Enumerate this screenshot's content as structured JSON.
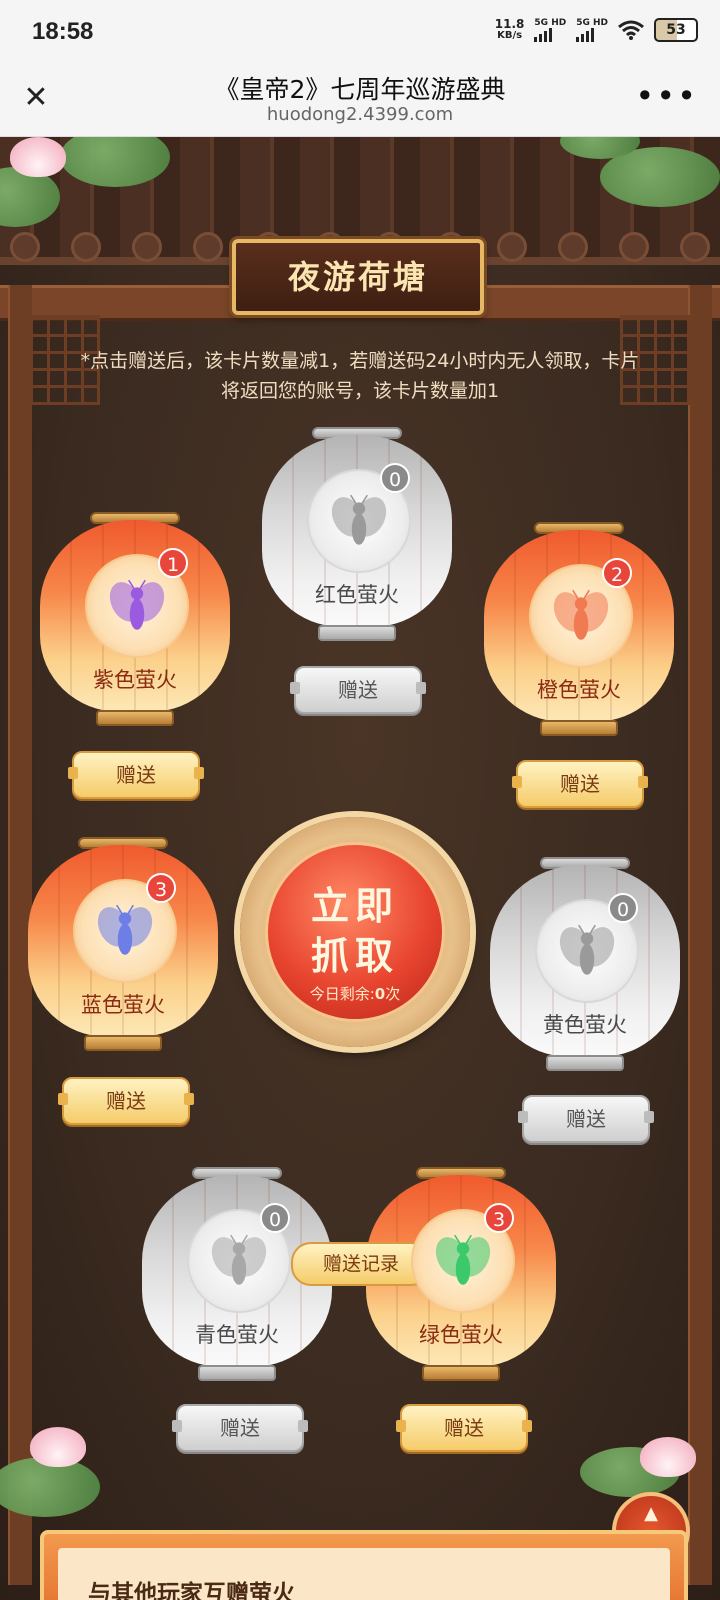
{
  "status": {
    "time": "18:58",
    "net_speed": "11.8",
    "net_unit": "KB/s",
    "sim1": "5G HD",
    "sim2": "5G HD",
    "battery": "53"
  },
  "nav": {
    "title": "《皇帝2》七周年巡游盛典",
    "url": "huodong2.4399.com",
    "close_icon": "close-icon",
    "more_icon": "more-icon"
  },
  "page": {
    "title": "夜游荷塘",
    "notice": "*点击赠送后，该卡片数量减1，若赠送码24小时内无人领取，卡片将返回您的账号，该卡片数量加1",
    "catch_line1": "立即",
    "catch_line2": "抓取",
    "remaining_label": "今日剩余:",
    "remaining_count": "0",
    "remaining_unit": "次",
    "record_label": "赠送记录",
    "top_label": "顶部",
    "bottom_title": "与其他玩家互赠萤火"
  },
  "fireflies": [
    {
      "id": "purple",
      "name": "紫色萤火",
      "count": "1",
      "active": true,
      "color": "#9b5be0",
      "gift": "赠送"
    },
    {
      "id": "red",
      "name": "红色萤火",
      "count": "0",
      "active": false,
      "color": "#9a9a9a",
      "gift": "赠送"
    },
    {
      "id": "orange",
      "name": "橙色萤火",
      "count": "2",
      "active": true,
      "color": "#f07a52",
      "gift": "赠送"
    },
    {
      "id": "blue",
      "name": "蓝色萤火",
      "count": "3",
      "active": true,
      "color": "#6d7fe6",
      "gift": "赠送"
    },
    {
      "id": "yellow",
      "name": "黄色萤火",
      "count": "0",
      "active": false,
      "color": "#9a9a9a",
      "gift": "赠送"
    },
    {
      "id": "cyan",
      "name": "青色萤火",
      "count": "0",
      "active": false,
      "color": "#a8a8a8",
      "gift": "赠送"
    },
    {
      "id": "green",
      "name": "绿色萤火",
      "count": "3",
      "active": true,
      "color": "#3cc969",
      "gift": "赠送"
    }
  ]
}
